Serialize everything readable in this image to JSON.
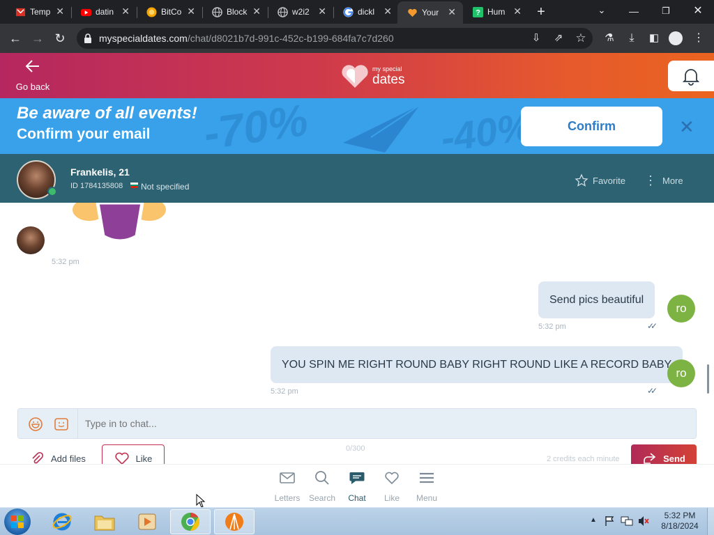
{
  "browser": {
    "tabs": [
      {
        "title": "Temp",
        "icon": "mail-icon",
        "color": "#d93025"
      },
      {
        "title": "datin",
        "icon": "youtube-icon",
        "color": "#ff0000"
      },
      {
        "title": "BitCo",
        "icon": "bitcoin-icon",
        "color": "#f7a600"
      },
      {
        "title": "Block",
        "icon": "globe-icon",
        "color": "#bdc1c6"
      },
      {
        "title": "w2i2",
        "icon": "globe-icon",
        "color": "#bdc1c6"
      },
      {
        "title": "dickl",
        "icon": "google-icon",
        "color": "#4285f4"
      },
      {
        "title": "Your",
        "icon": "heart-icon",
        "color": "#f29a2e"
      },
      {
        "title": "Hum",
        "icon": "help-icon",
        "color": "#1fc16b"
      }
    ],
    "active_tab_index": 6,
    "url_domain": "myspecialdates.com",
    "url_path": "/chat/d8021b7d-991c-452c-b199-684fa7c7d260"
  },
  "site": {
    "go_back_label": "Go back",
    "logo_small": "my special",
    "logo_big": "dates"
  },
  "promo": {
    "headline": "Be aware of all events!",
    "subline": "Confirm your email",
    "confirm_label": "Confirm",
    "bg_text_1": "-70%",
    "bg_text_2": "-40%"
  },
  "profile": {
    "name": "Frankelis, 21",
    "id_text": "ID 1784135808",
    "status_text": "Not specified",
    "favorite_label": "Favorite",
    "more_label": "More"
  },
  "chat": {
    "sticker_time": "5:32 pm",
    "messages": [
      {
        "text": "Send pics beautiful",
        "time": "5:32 pm",
        "avatar": "ro"
      },
      {
        "text": "YOU SPIN ME RIGHT ROUND BABY RIGHT ROUND LIKE A RECORD BABY",
        "time": "5:32 pm",
        "avatar": "ro"
      }
    ]
  },
  "composer": {
    "placeholder": "Type in to chat...",
    "char_count": "0/300",
    "add_files_label": "Add files",
    "like_label": "Like",
    "credits_text": "2 credits each minute",
    "send_label": "Send"
  },
  "bottom_nav": [
    {
      "label": "Letters",
      "icon": "envelope-icon"
    },
    {
      "label": "Search",
      "icon": "search-icon"
    },
    {
      "label": "Chat",
      "icon": "chat-icon"
    },
    {
      "label": "Like",
      "icon": "heart-icon"
    },
    {
      "label": "Menu",
      "icon": "menu-icon"
    }
  ],
  "active_nav": "Chat",
  "taskbar": {
    "time": "5:32 PM",
    "date": "8/18/2024"
  },
  "colors": {
    "header_start": "#b5275f",
    "header_end": "#ea6420",
    "promo_bg": "#39a0ea",
    "profile_bg": "#2d6273",
    "bubble_bg": "#dde8f2",
    "avatar_green": "#7cb342",
    "send_button": "#c0304f"
  }
}
